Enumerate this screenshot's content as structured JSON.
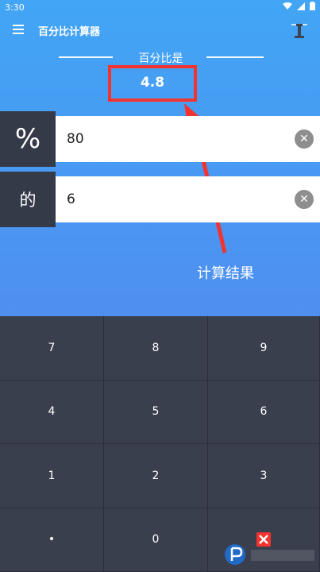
{
  "status": {
    "time": "3:30"
  },
  "app": {
    "title": "百分比计算器"
  },
  "result": {
    "caption": "百分比是",
    "value": "4.8"
  },
  "rows": [
    {
      "label": "%",
      "value": "80"
    },
    {
      "label": "的",
      "value": "6"
    }
  ],
  "annotation": "计算结果",
  "keypad": {
    "keys": [
      "7",
      "8",
      "9",
      "4",
      "5",
      "6",
      "1",
      "2",
      "3",
      "•",
      "0",
      ""
    ]
  },
  "colors": {
    "accent": "#42a5f5",
    "highlight": "#f2332f",
    "keypad_bg": "#3a3f4d"
  }
}
